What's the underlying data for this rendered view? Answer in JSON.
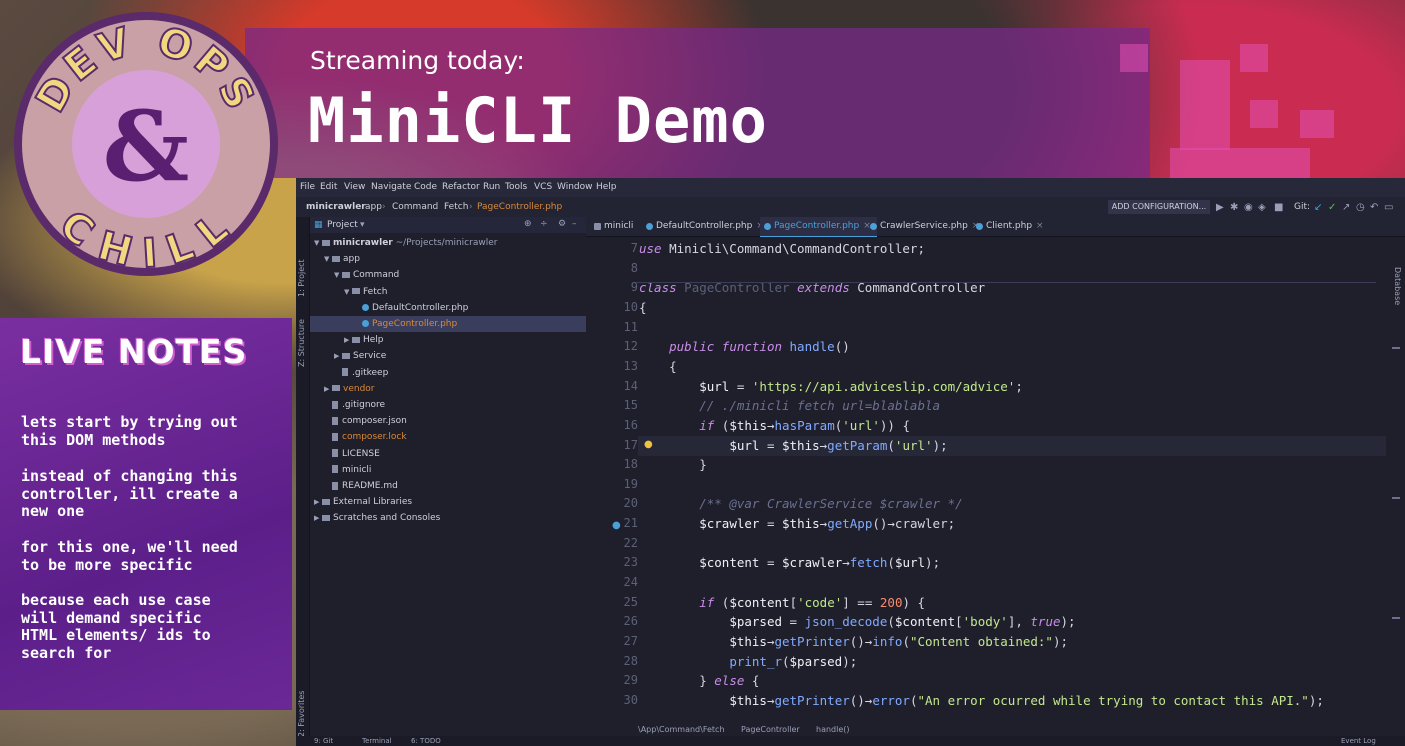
{
  "overlay": {
    "streaming_label": "Streaming today:",
    "title": "MiniCLI Demo",
    "logo": {
      "top": "DEV OPS",
      "amp": "&",
      "bottom": "CHILL"
    },
    "notes_title": "LIVE NOTES",
    "notes": [
      "lets start by trying out\nthis DOM methods",
      "instead of changing this\ncontroller, ill create a\nnew one",
      "for this one, we'll need\nto be more specific",
      "because each use case\nwill demand specific\nHTML elements/ ids to\nsearch for"
    ]
  },
  "ide": {
    "menu": [
      "File",
      "Edit",
      "View",
      "Navigate",
      "Code",
      "Refactor",
      "Run",
      "Tools",
      "VCS",
      "Window",
      "Help"
    ],
    "breadcrumb": [
      "minicrawler",
      "app",
      "Command",
      "Fetch",
      "PageController.php"
    ],
    "add_configuration": "ADD CONFIGURATION...",
    "git_label": "Git:",
    "project_panel_title": "Project",
    "side_labels": {
      "project": "1: Project",
      "structure": "Z: Structure",
      "favorites": "2: Favorites",
      "database": "Database"
    },
    "tree": [
      {
        "label": "minicrawler",
        "suffix": " ~/Projects/minicrawler",
        "depth": 0,
        "kind": "folder",
        "open": true
      },
      {
        "label": "app",
        "depth": 1,
        "kind": "folder",
        "open": true
      },
      {
        "label": "Command",
        "depth": 2,
        "kind": "folder",
        "open": true
      },
      {
        "label": "Fetch",
        "depth": 3,
        "kind": "folder",
        "open": true
      },
      {
        "label": "DefaultController.php",
        "depth": 4,
        "kind": "php"
      },
      {
        "label": "PageController.php",
        "depth": 4,
        "kind": "php",
        "selected": true,
        "color": "orange"
      },
      {
        "label": "Help",
        "depth": 3,
        "kind": "folder"
      },
      {
        "label": "Service",
        "depth": 2,
        "kind": "folder"
      },
      {
        "label": ".gitkeep",
        "depth": 2,
        "kind": "file"
      },
      {
        "label": "vendor",
        "depth": 1,
        "kind": "folder",
        "color": "orange"
      },
      {
        "label": ".gitignore",
        "depth": 1,
        "kind": "file"
      },
      {
        "label": "composer.json",
        "depth": 1,
        "kind": "file"
      },
      {
        "label": "composer.lock",
        "depth": 1,
        "kind": "file",
        "color": "orange"
      },
      {
        "label": "LICENSE",
        "depth": 1,
        "kind": "file"
      },
      {
        "label": "minicli",
        "depth": 1,
        "kind": "file"
      },
      {
        "label": "README.md",
        "depth": 1,
        "kind": "file"
      },
      {
        "label": "External Libraries",
        "depth": 0,
        "kind": "folder"
      },
      {
        "label": "Scratches and Consoles",
        "depth": 0,
        "kind": "folder"
      }
    ],
    "tabs": [
      {
        "label": "minicli",
        "active": false
      },
      {
        "label": "DefaultController.php",
        "active": false
      },
      {
        "label": "PageController.php",
        "active": true
      },
      {
        "label": "CrawlerService.php",
        "active": false
      },
      {
        "label": "Client.php",
        "active": false
      }
    ],
    "code_lines": [
      {
        "n": "7",
        "html": "<span class=\"kw\">use</span> Minicli\\Command\\CommandController;"
      },
      {
        "n": "8",
        "html": ""
      },
      {
        "n": "9",
        "html": "<span class=\"kw\">class</span> <span class=\"dim\">PageController</span> <span class=\"kw\">extends</span> CommandController"
      },
      {
        "n": "10",
        "html": "{"
      },
      {
        "n": "11",
        "html": ""
      },
      {
        "n": "12",
        "html": "    <span class=\"kw\">public function</span> <span class=\"fn\">handle</span>()"
      },
      {
        "n": "13",
        "html": "    {"
      },
      {
        "n": "14",
        "html": "        <span class=\"var\">$url</span> = <span class=\"str\">'https://api.adviceslip.com/advice'</span>;"
      },
      {
        "n": "15",
        "html": "        <span class=\"cm\">// ./minicli fetch url=blablabla</span>"
      },
      {
        "n": "16",
        "html": "        <span class=\"kw\">if</span> (<span class=\"var\">$this</span>→<span class=\"fn\">hasParam</span>(<span class=\"str\">'url'</span>)) {"
      },
      {
        "n": "17",
        "html": "            <span class=\"var\">$url</span> = <span class=\"var\">$this</span>→<span class=\"fn\">getParam</span>(<span class=\"str\">'url'</span>);"
      },
      {
        "n": "18",
        "html": "        }"
      },
      {
        "n": "19",
        "html": ""
      },
      {
        "n": "20",
        "html": "        <span class=\"cm\">/** @var CrawlerService $crawler */</span>"
      },
      {
        "n": "21",
        "html": "        <span class=\"var\">$crawler</span> = <span class=\"var\">$this</span>→<span class=\"fn\">getApp</span>()→crawler;"
      },
      {
        "n": "22",
        "html": ""
      },
      {
        "n": "23",
        "html": "        <span class=\"var\">$content</span> = <span class=\"var\">$crawler</span>→<span class=\"fn\">fetch</span>(<span class=\"var\">$url</span>);"
      },
      {
        "n": "24",
        "html": ""
      },
      {
        "n": "25",
        "html": "        <span class=\"kw\">if</span> (<span class=\"var\">$content</span>[<span class=\"str\">'code'</span>] == <span class=\"num\">200</span>) {"
      },
      {
        "n": "26",
        "html": "            <span class=\"var\">$parsed</span> = <span class=\"fn\">json_decode</span>(<span class=\"var\">$content</span>[<span class=\"str\">'body'</span>], <span class=\"kw\">true</span>);"
      },
      {
        "n": "27",
        "html": "            <span class=\"var\">$this</span>→<span class=\"fn\">getPrinter</span>()→<span class=\"fn\">info</span>(<span class=\"str\">\"Content obtained:\"</span>);"
      },
      {
        "n": "28",
        "html": "            <span class=\"fn\">print_r</span>(<span class=\"var\">$parsed</span>);"
      },
      {
        "n": "29",
        "html": "        } <span class=\"kw\">else</span> {"
      },
      {
        "n": "30",
        "html": "            <span class=\"var\">$this</span>→<span class=\"fn\">getPrinter</span>()→<span class=\"fn\">error</span>(<span class=\"str\">\"An error ocurred while trying to contact this API.\"</span>);"
      }
    ],
    "code_breadcrumbs": [
      "\\App\\Command\\Fetch",
      "PageController",
      "handle()"
    ],
    "bottom_tabs": [
      "9: Git",
      "Terminal",
      "6: TODO"
    ],
    "event_log": "Event Log"
  }
}
